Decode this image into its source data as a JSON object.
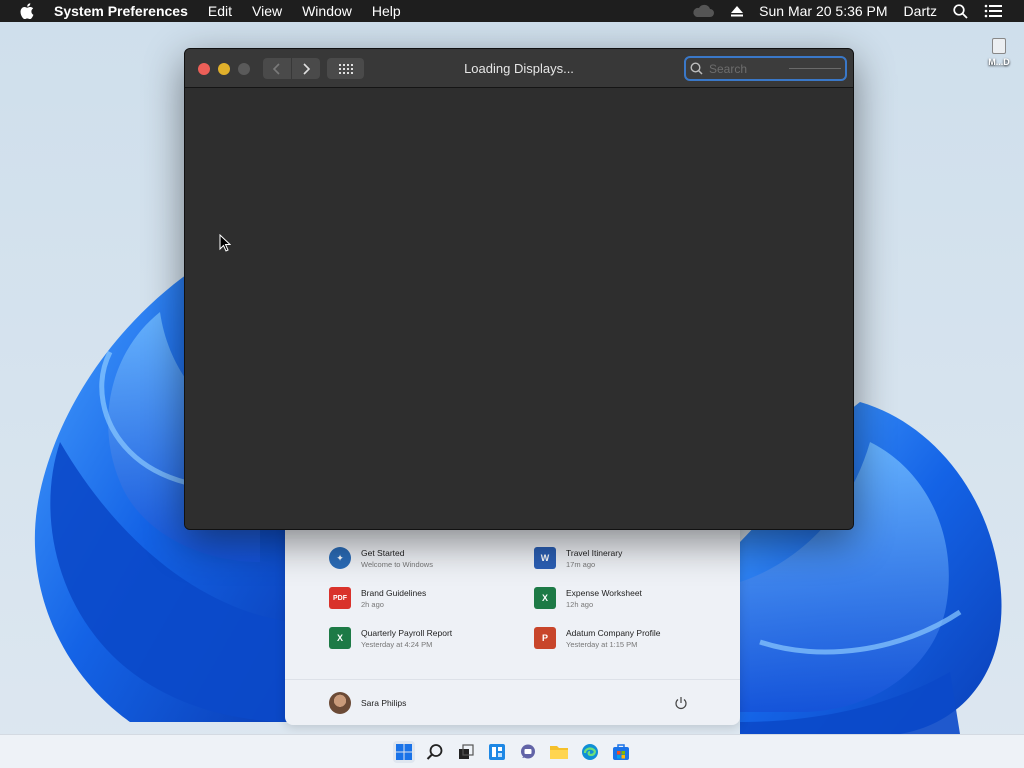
{
  "menubar": {
    "app_name": "System Preferences",
    "menus": [
      "Edit",
      "View",
      "Window",
      "Help"
    ],
    "clock": "Sun Mar 20  5:36 PM",
    "user": "Dartz",
    "icons": [
      "apple-icon",
      "cloud-icon",
      "eject-icon",
      "spotlight-icon",
      "control-center-icon"
    ]
  },
  "desktop": {
    "icon_label": "M...D"
  },
  "window": {
    "title": "Loading Displays...",
    "search_placeholder": "Search",
    "search_value": ""
  },
  "start_menu": {
    "recommended": [
      {
        "title": "Get Started",
        "subtitle": "Welcome to Windows",
        "icon": "get-started-icon",
        "color": "#2b6cb8"
      },
      {
        "title": "Travel Itinerary",
        "subtitle": "17m ago",
        "icon": "word-icon",
        "color": "#2b5fb5"
      },
      {
        "title": "Brand Guidelines",
        "subtitle": "2h ago",
        "icon": "pdf-icon",
        "color": "#d9322b"
      },
      {
        "title": "Expense Worksheet",
        "subtitle": "12h ago",
        "icon": "excel-icon",
        "color": "#1d7a46"
      },
      {
        "title": "Quarterly Payroll Report",
        "subtitle": "Yesterday at 4:24 PM",
        "icon": "excel-icon",
        "color": "#1d7a46"
      },
      {
        "title": "Adatum Company Profile",
        "subtitle": "Yesterday at 1:15 PM",
        "icon": "powerpoint-icon",
        "color": "#c8452a"
      }
    ],
    "user_name": "Sara Philips"
  },
  "taskbar": {
    "icons": [
      "start-icon",
      "search-icon",
      "task-view-icon",
      "widgets-icon",
      "chat-icon",
      "file-explorer-icon",
      "edge-icon",
      "store-icon"
    ]
  }
}
